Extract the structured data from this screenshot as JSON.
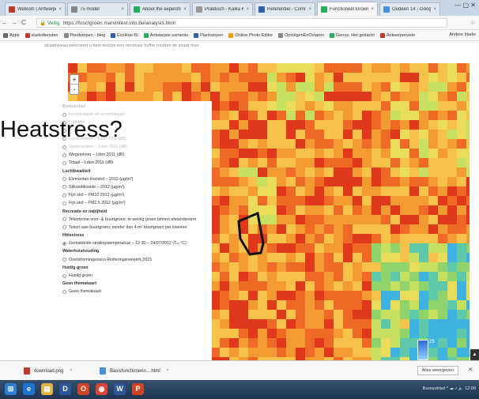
{
  "browser": {
    "tabs": [
      {
        "label": "Welkom | Antwerpen",
        "color": "#c0392b"
      },
      {
        "label": "75 model",
        "color": "#888888"
      },
      {
        "label": "About the experimen",
        "color": "#27ae60"
      },
      {
        "label": "Praktisch - Kaika Ko",
        "color": "#999999"
      },
      {
        "label": "Referentiel - Comm",
        "color": "#2e5fa8"
      },
      {
        "label": "Functioneel Groen -",
        "color": "#27ae60"
      },
      {
        "label": "Oudeen 14 - Google",
        "color": "#4a90d9"
      }
    ],
    "window_controls": "— ▢ ✕",
    "back": "←",
    "forward": "→",
    "reload": "C",
    "secure_label": "🔒 Veilig",
    "url": "https://functgroen.marvintest.vito.be/analysis.html",
    "bookmarks": [
      {
        "label": "Apps",
        "color": "#666666"
      },
      {
        "label": "stadsdiensten",
        "color": "#c0392b"
      },
      {
        "label": "Plantverpen - blog",
        "color": "#888888"
      },
      {
        "label": "EcoHuo-fS",
        "color": "#2e5fa8"
      },
      {
        "label": "Antwerpse samenlu",
        "color": "#27ae60"
      },
      {
        "label": "Plantverpen",
        "color": "#2e5fa8"
      },
      {
        "label": "Online Photo Editor",
        "color": "#f39c12"
      },
      {
        "label": "OpvolgenEnOctaren",
        "color": "#888888"
      },
      {
        "label": "Genus: Het gedacht",
        "color": "#27ae60"
      },
      {
        "label": "Antwerpenzele",
        "color": "#c0392b"
      }
    ],
    "bookmarks_right": "Andere bladw"
  },
  "page": {
    "intro_text": "straatniveau selecteert u best slechts een minimale buffer rondom de straat mee."
  },
  "overlay_title": "Heatstress?",
  "zoom": {
    "plus": "+",
    "minus": "-"
  },
  "layers": [
    {
      "type": "header",
      "label": "Bodemstad",
      "faded": true
    },
    {
      "type": "radio",
      "label": "Kernstrooken en ecorichtingen",
      "faded": true,
      "on": false
    },
    {
      "type": "radio",
      "label": "Lonnetst",
      "faded": true,
      "on": false
    },
    {
      "type": "radio",
      "label": "",
      "faded": true,
      "on": false
    },
    {
      "type": "radio",
      "label": "Luchtverkeer – Lden 2011 (dB)",
      "faded": true,
      "on": false
    },
    {
      "type": "radio",
      "label": "Spoorverkeer – Lden 2011 (dB)",
      "faded": true,
      "on": false
    },
    {
      "type": "radio",
      "label": "Wegverkeer – Lden 2011 (dB)",
      "faded": false,
      "on": false
    },
    {
      "type": "radio",
      "label": "Totaal – Lden 2011 (dB)",
      "faded": false,
      "on": false
    },
    {
      "type": "header",
      "label": "Luchtkwaliteit",
      "faded": false
    },
    {
      "type": "radio",
      "label": "Elementair koolstof – 2012 (µg/m³)",
      "faded": false,
      "on": false
    },
    {
      "type": "radio",
      "label": "Stikstofdioxide – 2012 (µg/m³)",
      "faded": false,
      "on": false
    },
    {
      "type": "radio",
      "label": "Fijn stof – PM10 2012 (µg/m³)",
      "faded": false,
      "on": false
    },
    {
      "type": "radio",
      "label": "Fijn stof – PM2.5 2012 (µg/m³)",
      "faded": false,
      "on": false
    },
    {
      "type": "header",
      "label": "Recreatie en nabijheid",
      "faded": false
    },
    {
      "type": "radio",
      "label": "Tekortzone voor- & buurtgroen: te weinig groen binnen afstandsnorm",
      "faded": false,
      "on": false
    },
    {
      "type": "radio",
      "label": "Tekort aan buurtgroen: minder dan 4 m² buurtgroen per inwoner",
      "faded": false,
      "on": false
    },
    {
      "type": "header",
      "label": "Hittestress",
      "faded": false
    },
    {
      "type": "radio",
      "label": "Gemiddelde stralingstemperatuur – 12:30 – 24/07/2012 (Tₘ °C)",
      "faded": false,
      "on": true
    },
    {
      "type": "header",
      "label": "Waterhuishouding",
      "faded": false
    },
    {
      "type": "radio",
      "label": "Overstromingsrisico Riolteringsnetwerk 2015",
      "faded": false,
      "on": false
    },
    {
      "type": "header",
      "label": "Huidig groen",
      "faded": false
    },
    {
      "type": "radio",
      "label": "Huidig groen",
      "faded": false,
      "on": false
    },
    {
      "type": "header",
      "label": "Geen themakaart",
      "faded": false
    },
    {
      "type": "radio",
      "label": "Geen themakaart",
      "faded": false,
      "on": false
    }
  ],
  "legend_value": "25",
  "side_button": "▲",
  "downloads": {
    "items": [
      {
        "label": "download.png",
        "color": "#c0392b"
      },
      {
        "label": "Basisfunctionerin....html",
        "color": "#4a90d9"
      }
    ],
    "chevron": "^",
    "show_all": "Alles weergeven",
    "close": "✕"
  },
  "taskbar": {
    "icons": [
      {
        "glyph": "⊞",
        "color": "#2d7dd2"
      },
      {
        "glyph": "e",
        "color": "#1b74d1"
      },
      {
        "glyph": "▤",
        "color": "#e3b341"
      },
      {
        "glyph": "D",
        "color": "#2b579a"
      },
      {
        "glyph": "O",
        "color": "#d04423"
      },
      {
        "glyph": "◉",
        "color": "#db4437"
      },
      {
        "glyph": "W",
        "color": "#2b579a"
      },
      {
        "glyph": "P",
        "color": "#d04423"
      }
    ],
    "tray_text": "Bureaublad  ^  ☁ ♪ 🔈  12:00"
  }
}
